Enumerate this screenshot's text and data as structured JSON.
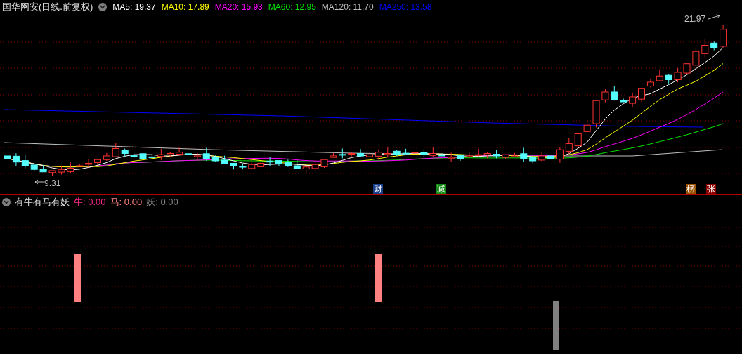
{
  "instrument": {
    "title": "国华网安(日线.前复权)"
  },
  "moving_averages": [
    {
      "label": "MA5:",
      "value": "19.37",
      "color": "#ffffff"
    },
    {
      "label": "MA10:",
      "value": "17.89",
      "color": "#ffff00"
    },
    {
      "label": "MA20:",
      "value": "15.93",
      "color": "#ff00ff"
    },
    {
      "label": "MA60:",
      "value": "12.95",
      "color": "#00e600"
    },
    {
      "label": "MA120:",
      "value": "11.70",
      "color": "#c0c0c0"
    },
    {
      "label": "MA250:",
      "value": "13.58",
      "color": "#0000ff"
    }
  ],
  "main_chart": {
    "high_label": "21.97",
    "low_label": "9.31",
    "events": [
      {
        "text": "财",
        "color": "#1a3f8a"
      },
      {
        "text": "减",
        "color": "#138a13"
      },
      {
        "text": "榜",
        "color": "#9a5200"
      },
      {
        "text": "张",
        "color": "#8a0000"
      }
    ]
  },
  "indicator": {
    "name": "有牛有马有妖",
    "values": [
      {
        "label": "牛:",
        "value": "0.00",
        "color": "#ff2a8a"
      },
      {
        "label": "马:",
        "value": "0.00",
        "color": "#ff8080"
      },
      {
        "label": "妖:",
        "value": "0.00",
        "color": "#808080"
      }
    ]
  }
}
